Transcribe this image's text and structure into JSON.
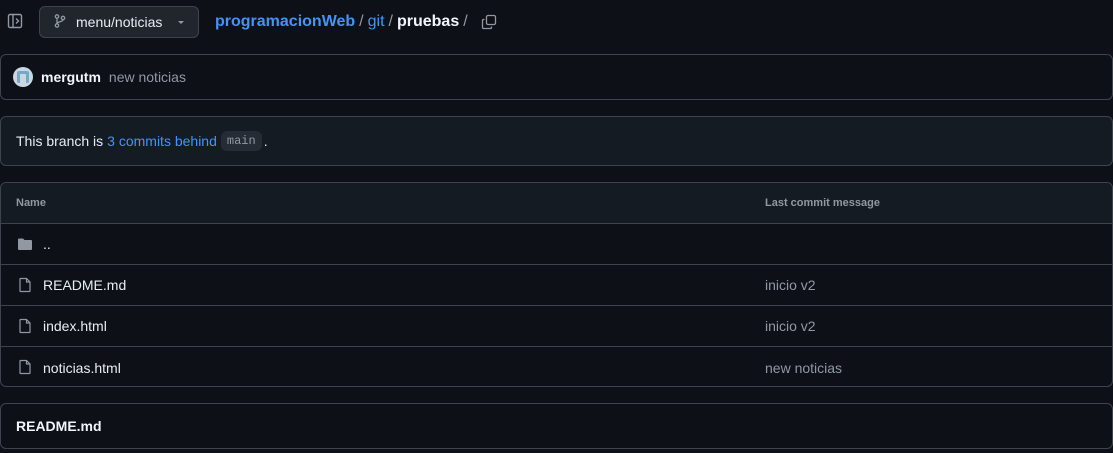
{
  "branch": {
    "name": "menu/noticias"
  },
  "breadcrumb": {
    "repo": "programacionWeb",
    "sep1": "/",
    "folder": "git",
    "sep2": "/",
    "current": "pruebas",
    "sep3": "/"
  },
  "commit": {
    "author": "mergutm",
    "message": "new noticias"
  },
  "branch_info": {
    "prefix": "This branch is",
    "link": "3 commits behind",
    "base": "main",
    "suffix": "."
  },
  "files": {
    "headers": {
      "name": "Name",
      "message": "Last commit message"
    },
    "rows": [
      {
        "name": "..",
        "message": "",
        "icon": "folder-icon"
      },
      {
        "name": "README.md",
        "message": "inicio v2",
        "icon": "file-icon"
      },
      {
        "name": "index.html",
        "message": "inicio v2",
        "icon": "file-icon"
      },
      {
        "name": "noticias.html",
        "message": "new noticias",
        "icon": "file-icon"
      }
    ]
  },
  "readme": {
    "title": "README.md"
  },
  "colors": {
    "accent": "#4493f8",
    "background": "#0d1117",
    "border": "#3d444d"
  }
}
